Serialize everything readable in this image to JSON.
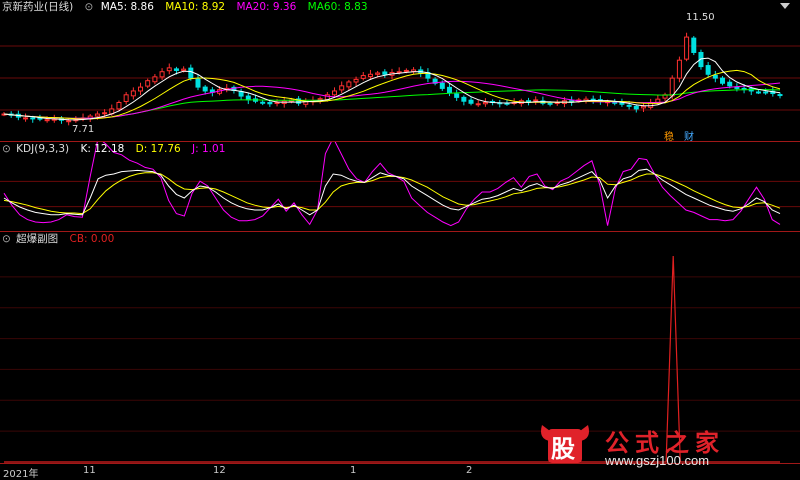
{
  "chart_data": [
    {
      "type": "candlestick",
      "title": "京新药业(日线)",
      "indicators": [
        {
          "name": "MA5",
          "label": "MA5: 8.86",
          "value": 8.86,
          "color": "#ffffff"
        },
        {
          "name": "MA10",
          "label": "MA10: 8.92",
          "value": 8.92,
          "color": "#ffff00"
        },
        {
          "name": "MA20",
          "label": "MA20: 9.36",
          "value": 9.36,
          "color": "#ff00ff"
        },
        {
          "name": "MA60",
          "label": "MA60: 8.83",
          "value": 8.83,
          "color": "#00ff00"
        }
      ],
      "annotations": [
        {
          "text": "11.50",
          "value": 11.5,
          "kind": "high"
        },
        {
          "text": "7.71",
          "value": 7.71,
          "kind": "low"
        }
      ],
      "markers": [
        "稳",
        "财"
      ],
      "ylim": [
        7.3,
        11.9
      ],
      "closes": [
        8.0,
        7.95,
        7.88,
        7.85,
        7.82,
        7.8,
        7.78,
        7.8,
        7.76,
        7.74,
        7.78,
        7.85,
        7.92,
        8.0,
        8.05,
        8.2,
        8.45,
        8.75,
        8.9,
        9.05,
        9.3,
        9.45,
        9.65,
        9.8,
        9.7,
        9.75,
        9.4,
        9.05,
        8.9,
        8.85,
        8.95,
        9.0,
        8.92,
        8.7,
        8.55,
        8.5,
        8.45,
        8.4,
        8.45,
        8.5,
        8.55,
        8.42,
        8.48,
        8.52,
        8.6,
        8.75,
        8.9,
        9.1,
        9.25,
        9.35,
        9.5,
        9.55,
        9.6,
        9.55,
        9.62,
        9.65,
        9.7,
        9.72,
        9.58,
        9.4,
        9.2,
        9.0,
        8.82,
        8.65,
        8.5,
        8.42,
        8.4,
        8.45,
        8.48,
        8.42,
        8.4,
        8.45,
        8.52,
        8.48,
        8.55,
        8.42,
        8.4,
        8.45,
        8.52,
        8.48,
        8.55,
        8.58,
        8.52,
        8.5,
        8.48,
        8.42,
        8.38,
        8.3,
        8.2,
        8.3,
        8.45,
        8.58,
        8.75,
        9.4,
        10.1,
        11.0,
        10.4,
        9.85,
        9.55,
        9.4,
        9.2,
        9.1,
        9.0,
        8.95,
        8.9,
        8.86,
        8.85,
        8.8,
        8.75
      ]
    },
    {
      "type": "line",
      "title": "KDJ(9,3,3)",
      "indicators": [
        {
          "name": "K",
          "label": "K: 12.18",
          "value": 12.18,
          "color": "#ffffff"
        },
        {
          "name": "D",
          "label": "D: 17.76",
          "value": 17.76,
          "color": "#ffff00"
        },
        {
          "name": "J",
          "label": "J: 1.01",
          "value": 1.01,
          "color": "#ff00ff"
        }
      ],
      "ylim": [
        -10,
        110
      ],
      "K": [
        40,
        32,
        25,
        20,
        16,
        14,
        12,
        12,
        14,
        13,
        12,
        40,
        72,
        78,
        80,
        84,
        85,
        86,
        85,
        84,
        78,
        60,
        46,
        40,
        52,
        60,
        58,
        50,
        40,
        32,
        26,
        22,
        20,
        20,
        24,
        30,
        22,
        28,
        20,
        12,
        20,
        60,
        80,
        78,
        72,
        68,
        66,
        74,
        82,
        78,
        76,
        72,
        60,
        52,
        44,
        36,
        28,
        22,
        20,
        26,
        32,
        38,
        40,
        44,
        50,
        56,
        52,
        60,
        64,
        58,
        56,
        62,
        66,
        72,
        78,
        84,
        70,
        40,
        60,
        72,
        76,
        86,
        88,
        80,
        70,
        62,
        54,
        46,
        40,
        34,
        28,
        24,
        20,
        18,
        22,
        30,
        40,
        34,
        20,
        14
      ],
      "D": [
        36,
        34,
        31,
        28,
        24,
        21,
        18,
        16,
        15,
        15,
        14,
        22,
        38,
        52,
        62,
        70,
        76,
        80,
        82,
        82,
        80,
        72,
        62,
        55,
        54,
        56,
        57,
        55,
        50,
        44,
        38,
        32,
        28,
        25,
        24,
        26,
        24,
        26,
        24,
        20,
        20,
        33,
        50,
        60,
        64,
        66,
        66,
        69,
        74,
        76,
        76,
        74,
        70,
        64,
        58,
        50,
        42,
        36,
        30,
        28,
        29,
        32,
        35,
        38,
        42,
        47,
        49,
        52,
        56,
        57,
        57,
        59,
        62,
        66,
        70,
        75,
        74,
        63,
        62,
        66,
        70,
        76,
        80,
        80,
        76,
        71,
        65,
        59,
        52,
        46,
        40,
        34,
        29,
        25,
        24,
        26,
        31,
        32,
        28,
        23
      ],
      "J": [
        48,
        28,
        12,
        4,
        0,
        -1,
        0,
        4,
        12,
        9,
        8,
        76,
        140,
        130,
        116,
        112,
        103,
        98,
        91,
        88,
        74,
        36,
        14,
        10,
        48,
        68,
        60,
        40,
        20,
        8,
        2,
        2,
        4,
        10,
        24,
        38,
        18,
        32,
        12,
        -4,
        20,
        114,
        140,
        114,
        88,
        72,
        66,
        84,
        98,
        82,
        76,
        68,
        40,
        28,
        16,
        8,
        0,
        -6,
        0,
        22,
        38,
        50,
        50,
        56,
        66,
        74,
        58,
        76,
        80,
        60,
        54,
        68,
        74,
        84,
        94,
        102,
        62,
        -6,
        56,
        84,
        88,
        106,
        104,
        80,
        58,
        44,
        32,
        20,
        16,
        10,
        4,
        4,
        2,
        4,
        18,
        38,
        58,
        38,
        4,
        -4
      ]
    },
    {
      "type": "line",
      "title": "超爆副图",
      "indicators": [
        {
          "name": "CB",
          "label": "CB: 0.00",
          "value": 0.0,
          "color": "#e02020"
        }
      ],
      "ylim": [
        0,
        100
      ],
      "values": [
        0,
        0,
        0,
        0,
        0,
        0,
        0,
        0,
        0,
        0,
        0,
        0,
        0,
        0,
        0,
        0,
        0,
        0,
        0,
        0,
        0,
        0,
        0,
        0,
        0,
        0,
        0,
        0,
        0,
        0,
        0,
        0,
        0,
        0,
        0,
        0,
        0,
        0,
        0,
        0,
        0,
        0,
        0,
        0,
        0,
        0,
        0,
        0,
        0,
        0,
        0,
        0,
        0,
        0,
        0,
        0,
        0,
        0,
        0,
        0,
        0,
        0,
        0,
        0,
        0,
        0,
        0,
        0,
        0,
        0,
        0,
        0,
        0,
        0,
        0,
        0,
        0,
        0,
        0,
        0,
        0,
        0,
        0,
        0,
        0,
        0,
        0,
        0,
        0,
        0,
        0,
        0,
        0,
        0,
        100,
        0,
        0,
        0,
        0,
        0,
        0,
        0,
        0,
        0,
        0,
        0,
        0,
        0,
        0,
        0
      ]
    }
  ],
  "xaxis": [
    "2021年",
    "11",
    "12",
    "1",
    "2"
  ],
  "watermark": {
    "cn": "公式之家",
    "url": "www.gszj100.com",
    "badge": "股"
  }
}
